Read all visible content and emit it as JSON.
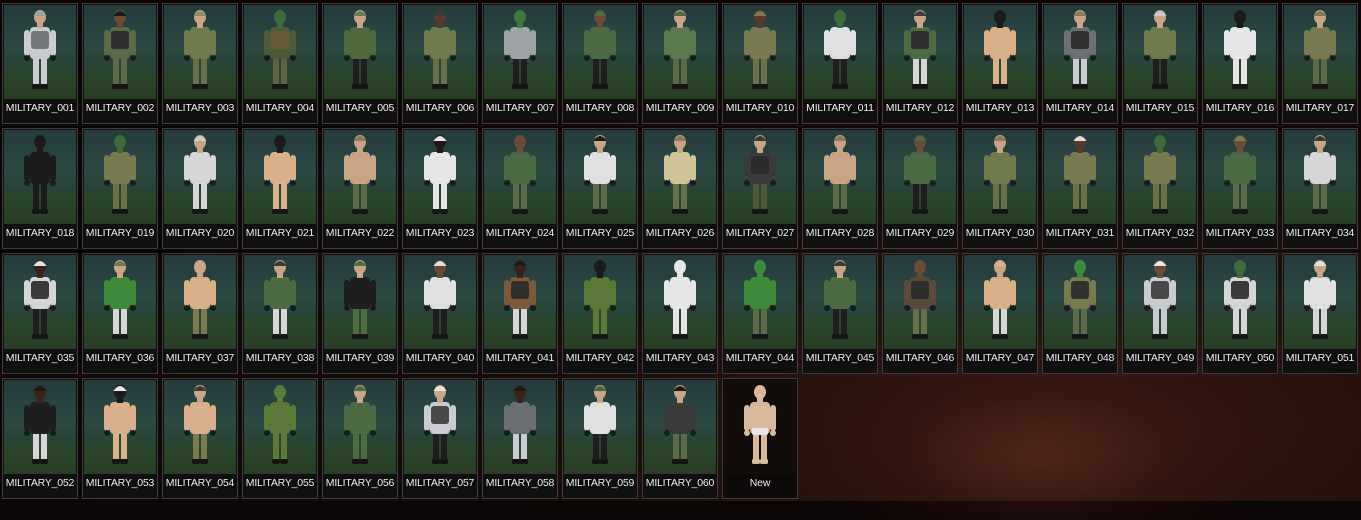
{
  "outfits": [
    {
      "label": "MILITARY_001",
      "top": "#c9cdd1",
      "bottom": "#c9cdd1",
      "head": "#c9a487",
      "hat": "#9aa39a",
      "vest": "#6b6f73"
    },
    {
      "label": "MILITARY_002",
      "top": "#5b6a46",
      "bottom": "#5a6a4a",
      "head": "#6b4a35",
      "hat": "#1b1b1b",
      "vest": "#2a2a2a"
    },
    {
      "label": "MILITARY_003",
      "top": "#6f7a4d",
      "bottom": "#66704a",
      "head": "#c9a487",
      "hat": "#8a8e6a",
      "vest": ""
    },
    {
      "label": "MILITARY_004",
      "top": "#4d5a37",
      "bottom": "#5b6340",
      "head": "#3f6b3a",
      "hat": "#3f6b3a",
      "vest": "#6b5a3a"
    },
    {
      "label": "MILITARY_005",
      "top": "#4f6a3d",
      "bottom": "#1e1e1e",
      "head": "#c9a487",
      "hat": "#6b7a5a",
      "vest": ""
    },
    {
      "label": "MILITARY_006",
      "top": "#6f7a4d",
      "bottom": "#66704a",
      "head": "#5a3a28",
      "hat": "#3a3a3a",
      "vest": ""
    },
    {
      "label": "MILITARY_007",
      "top": "#9ea3a6",
      "bottom": "#1e1e1e",
      "head": "#3f7a3a",
      "hat": "#3f7a3a",
      "vest": ""
    },
    {
      "label": "MILITARY_008",
      "top": "#4d6b43",
      "bottom": "#1e1e1e",
      "head": "#6b4a35",
      "hat": "#4d6b43",
      "vest": ""
    },
    {
      "label": "MILITARY_009",
      "top": "#5b7a4d",
      "bottom": "#5b6a4a",
      "head": "#c9a487",
      "hat": "#4d6b43",
      "vest": ""
    },
    {
      "label": "MILITARY_010",
      "top": "#7a7a52",
      "bottom": "#6b704a",
      "head": "#5a3a28",
      "hat": "#7a7a52",
      "vest": ""
    },
    {
      "label": "MILITARY_011",
      "top": "#e0e0e0",
      "bottom": "#1e1e1e",
      "head": "#3f6b3a",
      "hat": "#3f6b3a",
      "vest": ""
    },
    {
      "label": "MILITARY_012",
      "top": "#4d6b43",
      "bottom": "#d5d5d5",
      "head": "#c9a487",
      "hat": "#3a3a3a",
      "vest": "#2a2a2a"
    },
    {
      "label": "MILITARY_013",
      "top": "#d9b08c",
      "bottom": "#d9b08c",
      "head": "#1b1b1b",
      "hat": "#1b1b1b",
      "vest": ""
    },
    {
      "label": "MILITARY_014",
      "top": "#6b6f73",
      "bottom": "#c9cdd1",
      "head": "#c9a487",
      "hat": "#8a7a5a",
      "vest": "#2a2a2a"
    },
    {
      "label": "MILITARY_015",
      "top": "#6f7a4d",
      "bottom": "#1e1e1e",
      "head": "#c9a487",
      "hat": "#c9c9c9",
      "vest": ""
    },
    {
      "label": "MILITARY_016",
      "top": "#e6e6e6",
      "bottom": "#e6e6e6",
      "head": "#1b1b1b",
      "hat": "#1b1b1b",
      "vest": ""
    },
    {
      "label": "MILITARY_017",
      "top": "#7a7a52",
      "bottom": "#5b6a4a",
      "head": "#c9a487",
      "hat": "#7a7a52",
      "vest": ""
    },
    {
      "label": "MILITARY_018",
      "top": "#1b1b1b",
      "bottom": "#1b1b1b",
      "head": "#1b1b1b",
      "hat": "#1b1b1b",
      "vest": ""
    },
    {
      "label": "MILITARY_019",
      "top": "#7a7a52",
      "bottom": "#6b704a",
      "head": "#3f6b3a",
      "hat": "#3f6b3a",
      "vest": ""
    },
    {
      "label": "MILITARY_020",
      "top": "#d5d5d5",
      "bottom": "#d5d5d5",
      "head": "#c9a487",
      "hat": "#c9c9c9",
      "vest": ""
    },
    {
      "label": "MILITARY_021",
      "top": "#d9b08c",
      "bottom": "#d9b08c",
      "head": "#1b1b1b",
      "hat": "#1b1b1b",
      "vest": ""
    },
    {
      "label": "MILITARY_022",
      "top": "#c9a487",
      "bottom": "#5b6a4a",
      "head": "#c9a487",
      "hat": "#8a7a5a",
      "vest": ""
    },
    {
      "label": "MILITARY_023",
      "top": "#e6e6e6",
      "bottom": "#e6e6e6",
      "head": "#1b1b1b",
      "hat": "#e6e6e6",
      "vest": ""
    },
    {
      "label": "MILITARY_024",
      "top": "#4d6b43",
      "bottom": "#5b6a4a",
      "head": "#6b4a35",
      "hat": "#6b4a35",
      "vest": ""
    },
    {
      "label": "MILITARY_025",
      "top": "#e0e0e0",
      "bottom": "#5b6a4a",
      "head": "#c9a487",
      "hat": "#1b1b1b",
      "vest": ""
    },
    {
      "label": "MILITARY_026",
      "top": "#d0c39a",
      "bottom": "#66704a",
      "head": "#c9a487",
      "hat": "#8a7a5a",
      "vest": ""
    },
    {
      "label": "MILITARY_027",
      "top": "#3a3a3a",
      "bottom": "#4d5a37",
      "head": "#c9a487",
      "hat": "#3a3a3a",
      "vest": "#2a2a2a"
    },
    {
      "label": "MILITARY_028",
      "top": "#c9a487",
      "bottom": "#5b6a4a",
      "head": "#c9a487",
      "hat": "#8a7a5a",
      "vest": ""
    },
    {
      "label": "MILITARY_029",
      "top": "#4d6b43",
      "bottom": "#1e1e1e",
      "head": "#6b4a35",
      "hat": "#4d6b43",
      "vest": ""
    },
    {
      "label": "MILITARY_030",
      "top": "#6f7a4d",
      "bottom": "#66704a",
      "head": "#c9a487",
      "hat": "#8a7a5a",
      "vest": ""
    },
    {
      "label": "MILITARY_031",
      "top": "#7a7a52",
      "bottom": "#6b704a",
      "head": "#5a3a28",
      "hat": "#e0e0e0",
      "vest": ""
    },
    {
      "label": "MILITARY_032",
      "top": "#7a7a52",
      "bottom": "#6b704a",
      "head": "#3f6b3a",
      "hat": "#3f6b3a",
      "vest": ""
    },
    {
      "label": "MILITARY_033",
      "top": "#4d6b43",
      "bottom": "#5b6a4a",
      "head": "#6b4a35",
      "hat": "#7a7a52",
      "vest": ""
    },
    {
      "label": "MILITARY_034",
      "top": "#d5d5d5",
      "bottom": "#5b6a4a",
      "head": "#c9a487",
      "hat": "#3a3a3a",
      "vest": ""
    },
    {
      "label": "MILITARY_035",
      "top": "#d5d5d5",
      "bottom": "#1e1e1e",
      "head": "#3a2418",
      "hat": "#e6e6e6",
      "vest": "#2a2a2a"
    },
    {
      "label": "MILITARY_036",
      "top": "#3f8a3a",
      "bottom": "#d5d5d5",
      "head": "#c9a487",
      "hat": "#6b7a5a",
      "vest": ""
    },
    {
      "label": "MILITARY_037",
      "top": "#d9b08c",
      "bottom": "#7a7a52",
      "head": "#c9a487",
      "hat": "#c9a487",
      "vest": ""
    },
    {
      "label": "MILITARY_038",
      "top": "#4d6b43",
      "bottom": "#d5d5d5",
      "head": "#c9a487",
      "hat": "#3a3a3a",
      "vest": ""
    },
    {
      "label": "MILITARY_039",
      "top": "#1e1e1e",
      "bottom": "#4d6b43",
      "head": "#c9a487",
      "hat": "#4d6b43",
      "vest": ""
    },
    {
      "label": "MILITARY_040",
      "top": "#e0e0e0",
      "bottom": "#1e1e1e",
      "head": "#6b4a35",
      "hat": "#e0e0e0",
      "vest": ""
    },
    {
      "label": "MILITARY_041",
      "top": "#7a5a3a",
      "bottom": "#d5d5d5",
      "head": "#3a2418",
      "hat": "#1b1b1b",
      "vest": "#2a2a2a"
    },
    {
      "label": "MILITARY_042",
      "top": "#5b7a3a",
      "bottom": "#5b7a3a",
      "head": "#1b1b1b",
      "hat": "#1b1b1b",
      "vest": ""
    },
    {
      "label": "MILITARY_043",
      "top": "#e6e6e6",
      "bottom": "#e6e6e6",
      "head": "#e6e6e6",
      "hat": "#e6e6e6",
      "vest": ""
    },
    {
      "label": "MILITARY_044",
      "top": "#3f8a3a",
      "bottom": "#5b6a4a",
      "head": "#3f8a3a",
      "hat": "#3f8a3a",
      "vest": ""
    },
    {
      "label": "MILITARY_045",
      "top": "#4d6b43",
      "bottom": "#1e1e1e",
      "head": "#c9a487",
      "hat": "#3a3a3a",
      "vest": ""
    },
    {
      "label": "MILITARY_046",
      "top": "#5a4a3a",
      "bottom": "#66704a",
      "head": "#6b4a35",
      "hat": "#6b4a35",
      "vest": "#2a2a2a"
    },
    {
      "label": "MILITARY_047",
      "top": "#d9b08c",
      "bottom": "#d5d5d5",
      "head": "#c9a487",
      "hat": "#d9b08c",
      "vest": ""
    },
    {
      "label": "MILITARY_048",
      "top": "#7a7a52",
      "bottom": "#5b6a4a",
      "head": "#3f8a3a",
      "hat": "#3f8a3a",
      "vest": "#2a2a2a"
    },
    {
      "label": "MILITARY_049",
      "top": "#c9cdd1",
      "bottom": "#c9cdd1",
      "head": "#6b4a35",
      "hat": "#e6e6e6",
      "vest": "#3a3a3a"
    },
    {
      "label": "MILITARY_050",
      "top": "#d5d5d5",
      "bottom": "#d5d5d5",
      "head": "#3f6b3a",
      "hat": "#3f6b3a",
      "vest": "#2a2a2a"
    },
    {
      "label": "MILITARY_051",
      "top": "#e0e0e0",
      "bottom": "#d5d5d5",
      "head": "#c9a487",
      "hat": "#e0e0e0",
      "vest": ""
    },
    {
      "label": "MILITARY_052",
      "top": "#1e1e1e",
      "bottom": "#d5d5d5",
      "head": "#3a2418",
      "hat": "#1b1b1b",
      "vest": ""
    },
    {
      "label": "MILITARY_053",
      "top": "#d9b08c",
      "bottom": "#d9b08c",
      "head": "#1b1b1b",
      "hat": "#e6e6e6",
      "vest": ""
    },
    {
      "label": "MILITARY_054",
      "top": "#d9b08c",
      "bottom": "#7a7a52",
      "head": "#c9a487",
      "hat": "#3a3a3a",
      "vest": ""
    },
    {
      "label": "MILITARY_055",
      "top": "#5b7a3a",
      "bottom": "#5b7a3a",
      "head": "#5b7a3a",
      "hat": "#5b7a3a",
      "vest": ""
    },
    {
      "label": "MILITARY_056",
      "top": "#4d6b43",
      "bottom": "#4d6b43",
      "head": "#c9a487",
      "hat": "#4d6b43",
      "vest": ""
    },
    {
      "label": "MILITARY_057",
      "top": "#c9cdd1",
      "bottom": "#1e1e1e",
      "head": "#c9a487",
      "hat": "#e6e6e6",
      "vest": "#3a3a3a"
    },
    {
      "label": "MILITARY_058",
      "top": "#6b6f73",
      "bottom": "#c9cdd1",
      "head": "#3a2418",
      "hat": "#1b1b1b",
      "vest": ""
    },
    {
      "label": "MILITARY_059",
      "top": "#e0e0e0",
      "bottom": "#1e1e1e",
      "head": "#c9a487",
      "hat": "#3f6b3a",
      "vest": ""
    },
    {
      "label": "MILITARY_060",
      "top": "#3a3a3a",
      "bottom": "#5b6a4a",
      "head": "#c9a487",
      "hat": "#1b1b1b",
      "vest": ""
    }
  ],
  "new_tile": {
    "label": "New",
    "skin": "#d9b99c",
    "underwear": "#e6e6e6"
  }
}
